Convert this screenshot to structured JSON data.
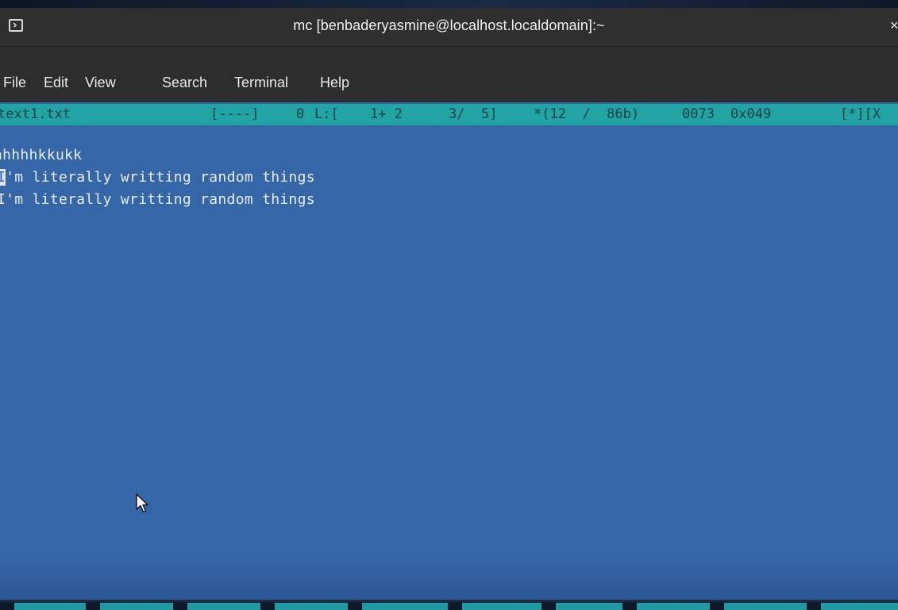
{
  "window": {
    "title": "mc [benbaderyasmine@localhost.localdomain]:~"
  },
  "menu": {
    "items": [
      {
        "label": "File"
      },
      {
        "label": "Edit"
      },
      {
        "label": "View"
      },
      {
        "label": "Search"
      },
      {
        "label": "Terminal"
      },
      {
        "label": "Help"
      }
    ]
  },
  "status": {
    "filename": "text1.txt",
    "flags": "[----]",
    "col": "0",
    "line_label": "L:[",
    "line_pos": "1+ 2",
    "line_total": "3/  5]",
    "bytes": "*(12  /  86b)",
    "char_dec": "0073",
    "char_hex": "0x049",
    "right": "[*][X"
  },
  "editor": {
    "lines": [
      "",
      "hhhhhkkukk",
      "I'm literally writting random things",
      "I'm literally writting random things"
    ],
    "cursor_char": "I"
  },
  "colors": {
    "editor_bg": "#3566a8",
    "status_bg": "#22a4a4",
    "title_bg": "#2f2f2f"
  },
  "icons": {
    "terminal": "terminal-icon",
    "pointer": "mouse-pointer-icon"
  }
}
